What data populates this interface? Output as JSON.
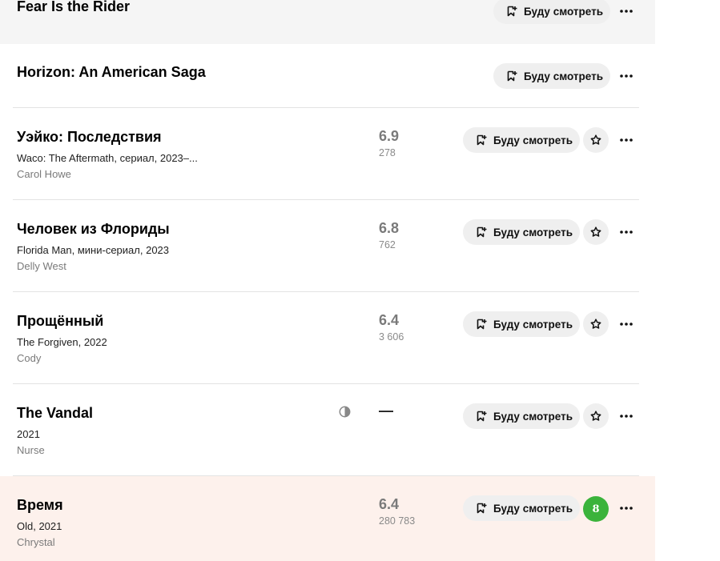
{
  "watch_label": "Буду смотреть",
  "colors": {
    "accent_green": "#3bb33b",
    "highlight_row": "#fdf1ec",
    "button_bg": "#efefef"
  },
  "items": [
    {
      "title": "Fear Is the Rider"
    },
    {
      "title": "Horizon: An American Saga"
    },
    {
      "title": "Уэйко: Последствия",
      "subtitle": "Waco: The Aftermath, сериал, 2023–...",
      "role": "Carol Howe",
      "rating": "6.9",
      "votes": "278"
    },
    {
      "title": "Человек из Флориды",
      "subtitle": "Florida Man, мини-сериал, 2023",
      "role": "Delly West",
      "rating": "6.8",
      "votes": "762"
    },
    {
      "title": "Прощённый",
      "subtitle": "The Forgiven, 2022",
      "role": "Cody",
      "rating": "6.4",
      "votes": "3 606"
    },
    {
      "title": "The Vandal",
      "subtitle": "2021",
      "role": "Nurse",
      "rating": "—",
      "icon": "clock-icon"
    },
    {
      "title": "Время",
      "subtitle": "Old, 2021",
      "role": "Chrystal",
      "rating": "6.4",
      "votes": "280 783",
      "user_score": "8"
    }
  ]
}
